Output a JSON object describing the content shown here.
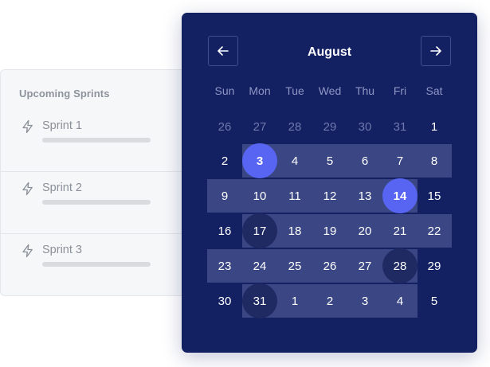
{
  "sprints": {
    "title": "Upcoming Sprints",
    "items": [
      {
        "name": "Sprint 1",
        "icon": "lightning-icon"
      },
      {
        "name": "Sprint 2",
        "icon": "lightning-icon"
      },
      {
        "name": "Sprint 3",
        "icon": "lightning-icon"
      }
    ]
  },
  "calendar": {
    "month": "August",
    "prev_icon": "arrow-left-icon",
    "next_icon": "arrow-right-icon",
    "weekdays": [
      "Sun",
      "Mon",
      "Tue",
      "Wed",
      "Thu",
      "Fri",
      "Sat"
    ],
    "weeks": [
      [
        {
          "d": "26",
          "state": "muted"
        },
        {
          "d": "27",
          "state": "muted"
        },
        {
          "d": "28",
          "state": "muted"
        },
        {
          "d": "29",
          "state": "muted"
        },
        {
          "d": "30",
          "state": "muted"
        },
        {
          "d": "31",
          "state": "muted"
        },
        {
          "d": "1",
          "state": ""
        }
      ],
      [
        {
          "d": "2",
          "state": ""
        },
        {
          "d": "3",
          "state": "selected"
        },
        {
          "d": "4",
          "state": ""
        },
        {
          "d": "5",
          "state": ""
        },
        {
          "d": "6",
          "state": ""
        },
        {
          "d": "7",
          "state": ""
        },
        {
          "d": "8",
          "state": ""
        }
      ],
      [
        {
          "d": "9",
          "state": ""
        },
        {
          "d": "10",
          "state": ""
        },
        {
          "d": "11",
          "state": ""
        },
        {
          "d": "12",
          "state": ""
        },
        {
          "d": "13",
          "state": ""
        },
        {
          "d": "14",
          "state": "selected"
        },
        {
          "d": "15",
          "state": ""
        }
      ],
      [
        {
          "d": "16",
          "state": ""
        },
        {
          "d": "17",
          "state": "marked"
        },
        {
          "d": "18",
          "state": ""
        },
        {
          "d": "19",
          "state": ""
        },
        {
          "d": "20",
          "state": ""
        },
        {
          "d": "21",
          "state": ""
        },
        {
          "d": "22",
          "state": ""
        }
      ],
      [
        {
          "d": "23",
          "state": ""
        },
        {
          "d": "24",
          "state": ""
        },
        {
          "d": "25",
          "state": ""
        },
        {
          "d": "26",
          "state": ""
        },
        {
          "d": "27",
          "state": ""
        },
        {
          "d": "28",
          "state": "marked"
        },
        {
          "d": "29",
          "state": ""
        }
      ],
      [
        {
          "d": "30",
          "state": ""
        },
        {
          "d": "31",
          "state": "marked"
        },
        {
          "d": "1",
          "state": ""
        },
        {
          "d": "2",
          "state": ""
        },
        {
          "d": "3",
          "state": ""
        },
        {
          "d": "4",
          "state": ""
        },
        {
          "d": "5",
          "state": ""
        }
      ]
    ],
    "ranges": [
      {
        "from": "3",
        "to": "8"
      },
      {
        "from": "9",
        "to": "14"
      },
      {
        "from": "17",
        "to": "22"
      },
      {
        "from": "23",
        "to": "28"
      },
      {
        "from": "31",
        "to": "4"
      }
    ],
    "colors": {
      "background": "#132062",
      "range": "#3b4784",
      "selected": "#5865f2",
      "marked": "#1f2a63"
    }
  }
}
